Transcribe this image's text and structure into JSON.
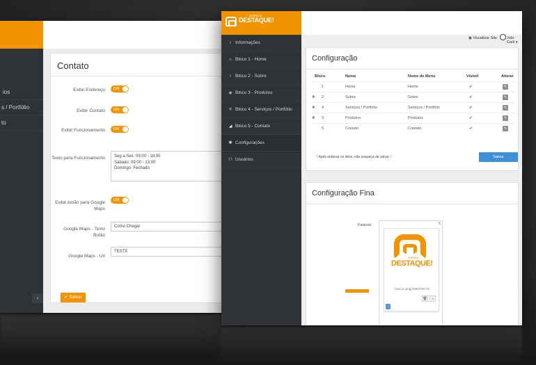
{
  "left": {
    "sidebar_items": [
      "ios",
      "s / Portfólio",
      "to"
    ],
    "title": "Contato",
    "fields": [
      {
        "label": "Exibir Endereço",
        "toggle": "ON"
      },
      {
        "label": "Exibir Contato",
        "toggle": "ON"
      },
      {
        "label": "Exibir Funcionamento",
        "toggle": "ON"
      },
      {
        "label": "Texto para Funcionamento",
        "value": "Seg a Sex: 09:00 - 18:00\nSábado: 09:00 - 13:00\nDomingo: Fechado"
      },
      {
        "label": "Exibir botão para Google Maps",
        "toggle": "ON"
      },
      {
        "label": "Google Maps - Texto Botão",
        "value": "Como Chegar"
      },
      {
        "label": "Google Maps - Url",
        "value": "TESTE"
      }
    ],
    "save_label": "Salvar",
    "collapse": "‹"
  },
  "right": {
    "brand": {
      "word": "DESTAQUE!",
      "sub": "AGÊNCIA"
    },
    "header": {
      "visit": "Visualizar Site",
      "user": "Jobi Carli"
    },
    "sidebar": [
      {
        "icon": "info-icon",
        "glyph": "i",
        "label": "Informações"
      },
      {
        "icon": "home-icon",
        "glyph": "⌂",
        "label": "Bloco 1 - Home"
      },
      {
        "icon": "info-icon",
        "glyph": "i",
        "label": "Bloco 2 - Sobre"
      },
      {
        "icon": "tag-icon",
        "glyph": "◈",
        "label": "Bloco 3 - Produtos"
      },
      {
        "icon": "list-icon",
        "glyph": "≡",
        "label": "Bloco 4 - Serviços / Portfólio"
      },
      {
        "icon": "send-icon",
        "glyph": "◢",
        "label": "Bloco 5 - Contato"
      },
      {
        "icon": "gear-icon",
        "glyph": "✱",
        "label": "Configurações"
      },
      {
        "icon": "users-icon",
        "glyph": "⚇",
        "label": "Usuários"
      }
    ],
    "config": {
      "title": "Configuração",
      "headers": [
        "Bloco",
        "Nome",
        "Nome do Menu",
        "Visível",
        "Alterar"
      ],
      "rows": [
        {
          "drag": "",
          "bloco": "1",
          "nome": "Home",
          "menu": "Home",
          "visible": "✔"
        },
        {
          "drag": "✥",
          "bloco": "2",
          "nome": "Sobre",
          "menu": "Sobre",
          "visible": "✔"
        },
        {
          "drag": "✥",
          "bloco": "4",
          "nome": "Serviços / Portfólio",
          "menu": "Serviços / Portfólio",
          "visible": "✔"
        },
        {
          "drag": "✥",
          "bloco": "3",
          "nome": "Produtos",
          "menu": "Produtos",
          "visible": "✔"
        },
        {
          "drag": "",
          "bloco": "5",
          "nome": "Contato",
          "menu": "Contato",
          "visible": "✔"
        }
      ],
      "note": "! Após ordenar os itens, não esqueça de salvar !",
      "save_label": "Salvar"
    },
    "config_fine": {
      "title": "Configuração Fina",
      "favicon_label": "Favicon",
      "file_name": "favicon.png(1560705775",
      "logo_word": "DESTAQUE!",
      "logo_sub": "AGÊNCIA",
      "close": "x"
    }
  },
  "colors": {
    "accent": "#f29400",
    "sidebar": "#2f3237",
    "primary": "#3d8fd6",
    "check": "#2aa37a"
  }
}
